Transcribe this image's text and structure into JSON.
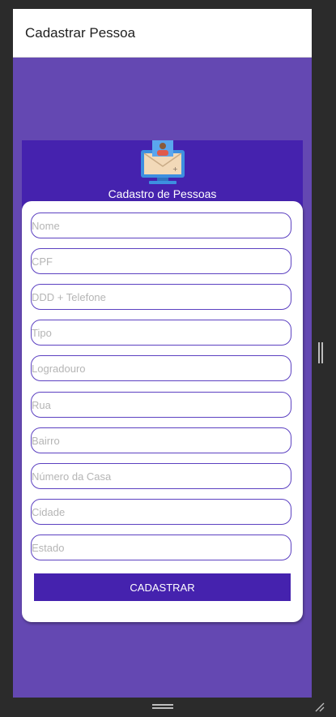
{
  "appbar": {
    "title": "Cadastrar Pessoa"
  },
  "hero": {
    "icon": "person-monitor-icon",
    "title": "Cadastro de Pessoas"
  },
  "form": {
    "fields": [
      {
        "name": "nome",
        "placeholder": "Nome",
        "value": ""
      },
      {
        "name": "cpf",
        "placeholder": "CPF",
        "value": ""
      },
      {
        "name": "telefone",
        "placeholder": "DDD + Telefone",
        "value": ""
      },
      {
        "name": "tipo",
        "placeholder": "Tipo",
        "value": ""
      },
      {
        "name": "logradouro",
        "placeholder": "Logradouro",
        "value": ""
      },
      {
        "name": "rua",
        "placeholder": "Rua",
        "value": ""
      },
      {
        "name": "bairro",
        "placeholder": "Bairro",
        "value": ""
      },
      {
        "name": "numero",
        "placeholder": "Número da Casa",
        "value": ""
      },
      {
        "name": "cidade",
        "placeholder": "Cidade",
        "value": ""
      },
      {
        "name": "estado",
        "placeholder": "Estado",
        "value": ""
      }
    ],
    "submit_label": "CADASTRAR"
  },
  "colors": {
    "background": "#6448b2",
    "primary": "#4522ae",
    "field_border": "#5c41c1"
  }
}
